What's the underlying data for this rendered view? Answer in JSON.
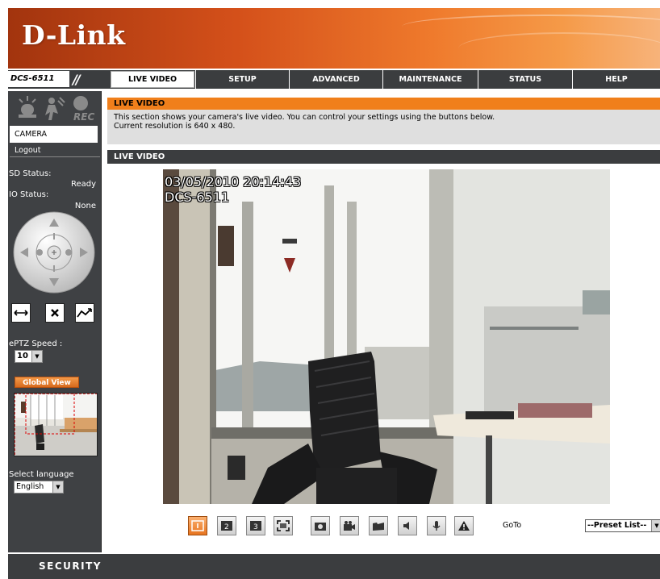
{
  "brand": {
    "logo": "D-Link",
    "footer": "SECURITY"
  },
  "nav": {
    "model": "DCS-6511",
    "tabs": [
      {
        "label": "LIVE VIDEO",
        "active": true
      },
      {
        "label": "SETUP"
      },
      {
        "label": "ADVANCED"
      },
      {
        "label": "MAINTENANCE"
      },
      {
        "label": "STATUS"
      },
      {
        "label": "HELP"
      }
    ]
  },
  "sidebar": {
    "rec_label": "REC",
    "camera_label": "CAMERA",
    "logout_label": "Logout",
    "sd_status_label": "SD Status:",
    "sd_status_value": "Ready",
    "io_status_label": "IO Status:",
    "io_status_value": "None",
    "eptz_speed_label": "ePTZ Speed :",
    "eptz_speed_value": "10",
    "global_view_label": "Global View",
    "select_language_label": "Select language",
    "language_value": "English"
  },
  "main": {
    "section_title": "LIVE VIDEO",
    "description_line1": "This section shows your camera's live video. You can control your settings using the buttons below.",
    "description_line2": "Current resolution is 640 x 480.",
    "video_title": "LIVE VIDEO",
    "overlay_timestamp": "03/05/2010 20:14:43",
    "overlay_camera": "DCS-6511",
    "goto_label": "GoTo",
    "preset_value": "--Preset List--"
  },
  "colors": {
    "accent": "#f07f1b",
    "nav_bg": "#3b3d3f",
    "sidebar_bg": "#3f4144"
  }
}
